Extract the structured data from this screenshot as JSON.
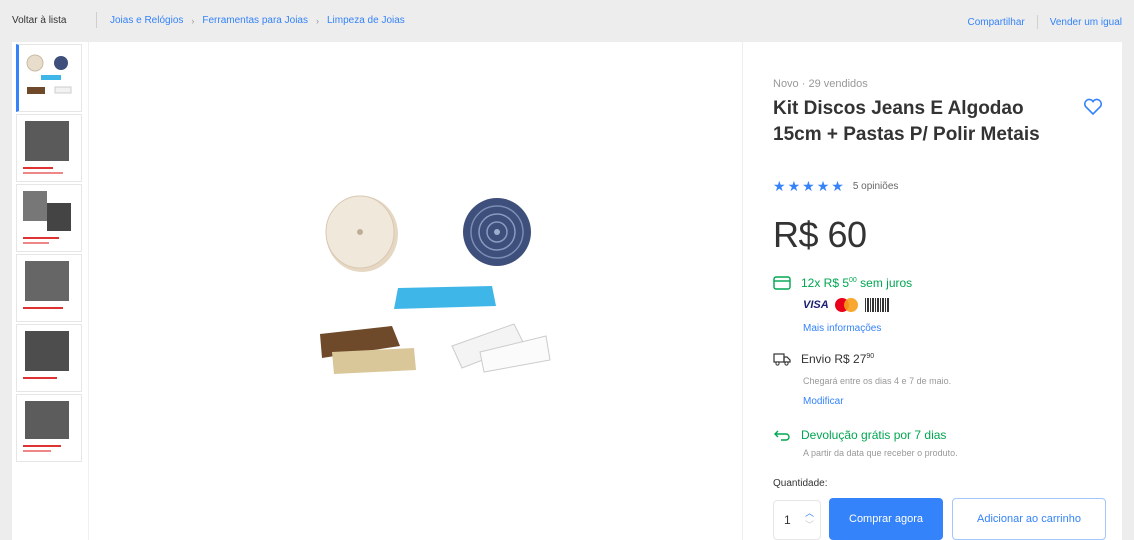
{
  "nav": {
    "back_label": "Voltar à lista",
    "breadcrumbs": [
      "Joias e Relógios",
      "Ferramentas para Joias",
      "Limpeza de Joias"
    ],
    "share_label": "Compartilhar",
    "sell_label": "Vender um igual"
  },
  "product": {
    "condition": "Novo  ·  29 vendidos",
    "title": "Kit Discos Jeans E Algodao 15cm + Pastas P/ Polir Metais",
    "rating_stars": 5,
    "reviews_label": "5 opiniões",
    "price": "R$ 60"
  },
  "payment": {
    "installments_main": "12x R$ 5",
    "installments_cents": "00",
    "installments_suffix": " sem juros",
    "methods": [
      "VISA",
      "Mastercard",
      "Boleto"
    ],
    "more_info": "Mais informações"
  },
  "shipping": {
    "label": "Envio R$ 27",
    "cents": "90",
    "note": "Chegará entre os dias 4 e 7 de maio.",
    "modify_label": "Modificar"
  },
  "returns": {
    "label": "Devolução grátis por 7 dias",
    "note": "A partir da data que receber o produto."
  },
  "purchase": {
    "quantity_label": "Quantidade:",
    "quantity_value": "1",
    "buy_now": "Comprar agora",
    "add_to_cart": "Adicionar ao carrinho"
  },
  "icons": [
    "heart-icon",
    "star-icon",
    "card-icon",
    "truck-icon",
    "return-icon",
    "chevron-right-icon"
  ],
  "colors": {
    "accent": "#3483fa",
    "success": "#00a650",
    "background": "#ededed"
  }
}
